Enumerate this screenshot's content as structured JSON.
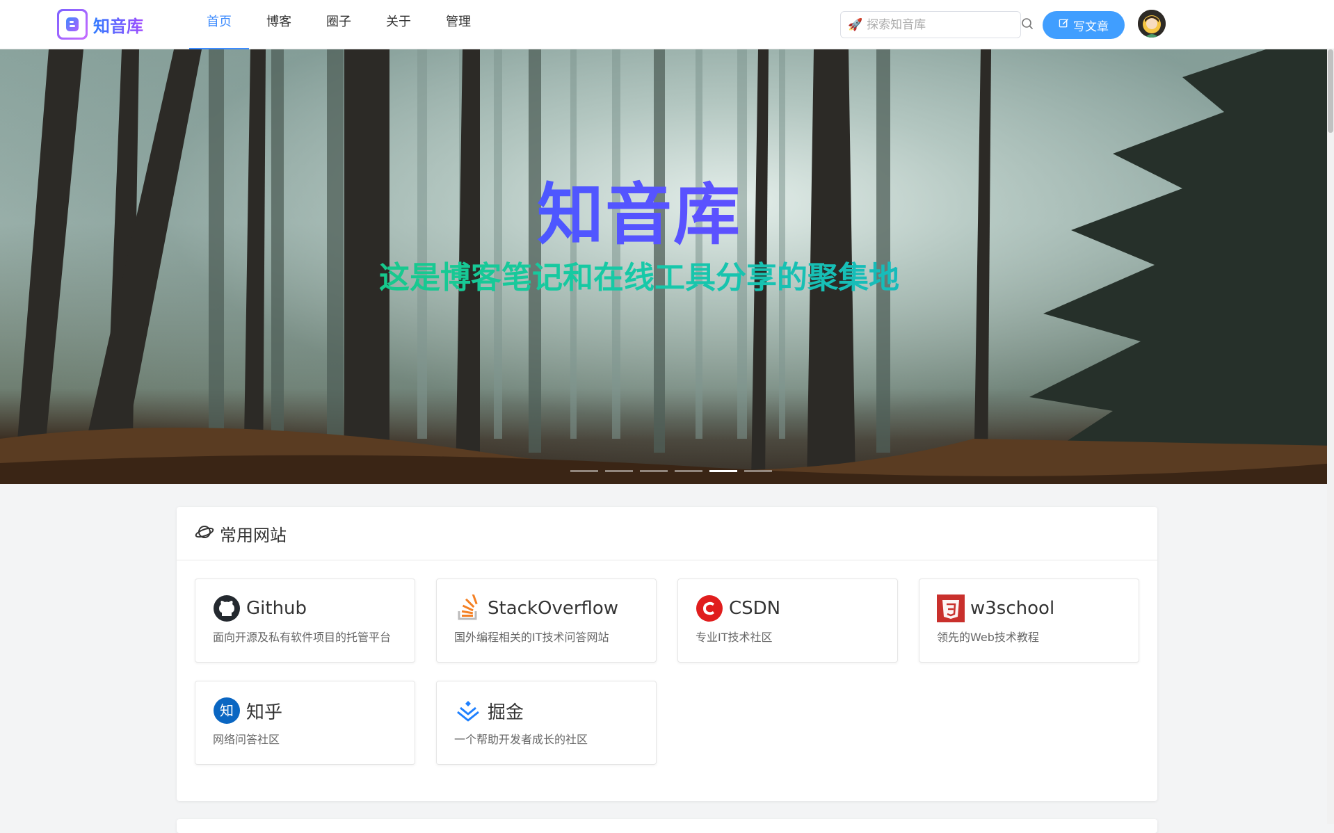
{
  "header": {
    "logo_text": "知音库",
    "nav": [
      {
        "label": "首页",
        "active": true
      },
      {
        "label": "博客",
        "active": false
      },
      {
        "label": "圈子",
        "active": false
      },
      {
        "label": "关于",
        "active": false
      },
      {
        "label": "管理",
        "active": false
      }
    ],
    "search_placeholder": "探索知音库",
    "write_label": "写文章"
  },
  "banner": {
    "title": "知音库",
    "subtitle": "这是博客笔记和在线工具分享的聚集地",
    "slides_count": 6,
    "active_slide": 5
  },
  "sites_section": {
    "title": "常用网站",
    "sites": [
      {
        "name": "Github",
        "desc": "面向开源及私有软件项目的托管平台",
        "icon": "github-icon"
      },
      {
        "name": "StackOverflow",
        "desc": "国外编程相关的IT技术问答网站",
        "icon": "stackoverflow-icon"
      },
      {
        "name": "CSDN",
        "desc": "专业IT技术社区",
        "icon": "csdn-icon"
      },
      {
        "name": "w3school",
        "desc": "领先的Web技术教程",
        "icon": "w3school-icon"
      },
      {
        "name": "知乎",
        "desc": "网络问答社区",
        "icon": "zhihu-icon"
      },
      {
        "name": "掘金",
        "desc": "一个帮助开发者成长的社区",
        "icon": "juejin-icon"
      }
    ]
  },
  "colors": {
    "accent": "#409eff",
    "nav_active": "#3d8bfd"
  }
}
